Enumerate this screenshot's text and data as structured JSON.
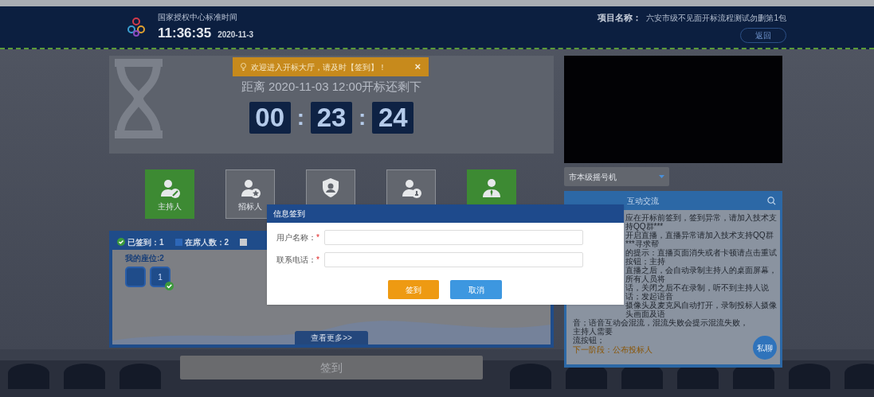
{
  "header": {
    "time_label": "国家授权中心标准时间",
    "time": "11:36:35",
    "date": "2020-11-3",
    "project_label": "项目名称：",
    "project_name": "六安市级不见面开标流程测试勿删第1包",
    "back_button": "返回"
  },
  "toast": {
    "text": "欢迎进入开标大厅，请及时【签到】！",
    "close": "×"
  },
  "countdown": {
    "title": "距离 2020-11-03 12:00开标还剩下",
    "hours": "00",
    "minutes": "23",
    "seconds": "24",
    "separator": ":"
  },
  "roles": [
    {
      "label": "主持人",
      "active": true
    },
    {
      "label": "招标人",
      "active": false
    },
    {
      "active": false
    },
    {
      "active": false
    },
    {
      "active": true
    }
  ],
  "seats": {
    "signed_label": "已签到：1",
    "present_label": "在席人数：2",
    "my_seat": "我的座位:2",
    "items": [
      {
        "checked": false
      },
      {
        "number": "1",
        "checked": true
      }
    ],
    "more": "查看更多>>"
  },
  "sign_button": "签到",
  "video": {
    "device": "市本级摇号机"
  },
  "chat": {
    "title": "互动交流",
    "beside_dialog": [
      "应在开标前签到，签到异常，请加入技术支持QQ群***",
      "开启直播，直播异常请加入技术支持QQ群***寻求帮",
      "的提示：直播页面消失或者卡顿请点击重试按钮；主持",
      "直播之后，会自动录制主持人的桌面屏幕，所有人员将",
      "话，关闭之后不在录制，听不到主持人说话；发起语音",
      "摄像头及麦克风自动打开，录制投标人摄像头画面及语"
    ],
    "lines": [
      "音；语音互动会混流，混流失败会提示混流失败，主持人需要",
      "流按钮；"
    ],
    "next_stage": "下一阶段：公布投标人",
    "private_button": "私聊"
  },
  "dialog": {
    "title": "信息签到",
    "required_mark": "*",
    "fields": [
      {
        "label": "用户名称：",
        "required": true
      },
      {
        "label": "联系电话：",
        "required": true
      }
    ],
    "confirm": "签到",
    "cancel": "取消"
  }
}
